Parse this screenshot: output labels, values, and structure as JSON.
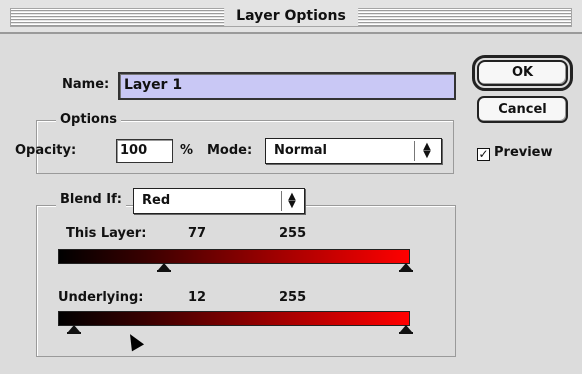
{
  "window": {
    "title": "Layer Options"
  },
  "name_field": {
    "label": "Name:",
    "value": "Layer 1"
  },
  "options": {
    "group_label": "Options",
    "opacity_label": "Opacity:",
    "opacity_value": "100",
    "percent_symbol": "%",
    "mode_label": "Mode:",
    "mode_value": "Normal"
  },
  "buttons": {
    "ok": "OK",
    "cancel": "Cancel"
  },
  "preview": {
    "label": "Preview",
    "checked": true
  },
  "blend_if": {
    "label": "Blend If:",
    "channel": "Red",
    "this_layer": {
      "label": "This Layer:",
      "low": "77",
      "high": "255"
    },
    "underlying": {
      "label": "Underlying:",
      "low": "12",
      "high": "255"
    }
  },
  "colors": {
    "field_highlight": "#c9c8f5",
    "gradient_end": "#ff0000"
  }
}
